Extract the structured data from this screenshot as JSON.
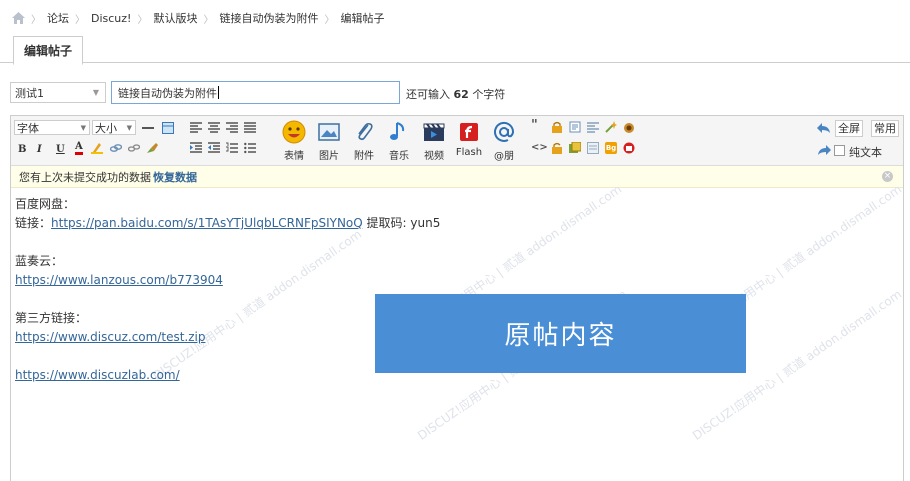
{
  "breadcrumb": {
    "items": [
      "论坛",
      "Discuz!",
      "默认版块",
      "链接自动伪装为附件",
      "编辑帖子"
    ]
  },
  "tab": {
    "label": "编辑帖子"
  },
  "form": {
    "type_select": "测试1",
    "subject_value": "链接自动伪装为附件",
    "limit_prefix": "还可输入",
    "limit_count": "62",
    "limit_suffix": "个字符"
  },
  "toolbar": {
    "font_select": "字体",
    "size_select": "大小",
    "format_buttons": [
      "B",
      "I",
      "U",
      "A"
    ],
    "big_buttons": [
      "表情",
      "图片",
      "附件",
      "音乐",
      "视频",
      "Flash",
      "@朋"
    ],
    "fullscreen": "全屏",
    "common": "常用",
    "plaintext": "纯文本"
  },
  "notice": {
    "text": "您有上次未提交成功的数据",
    "restore": "恢复数据"
  },
  "content": {
    "baidu_label": "百度网盘：",
    "baidu_link_prefix": "链接：",
    "baidu_link": "https://pan.baidu.com/s/1TAsYTjUlqbLCRNFpSIYNoQ",
    "baidu_code": " 提取码: yun5",
    "lanzou_label": "蓝奏云：",
    "lanzou_link": "https://www.lanzous.com/b773904",
    "third_label": "第三方链接：",
    "third_link": "https://www.discuz.com/test.zip",
    "lab_link": "https://www.discuzlab.com/"
  },
  "overlay": {
    "text": "原帖内容"
  },
  "watermark": {
    "text": "DISCUZ!应用中心 | 贰道 addon.dismall.com"
  },
  "colors": {
    "accent": "#4a8fd6",
    "link": "#336699",
    "notice_bg": "#fefee9"
  }
}
